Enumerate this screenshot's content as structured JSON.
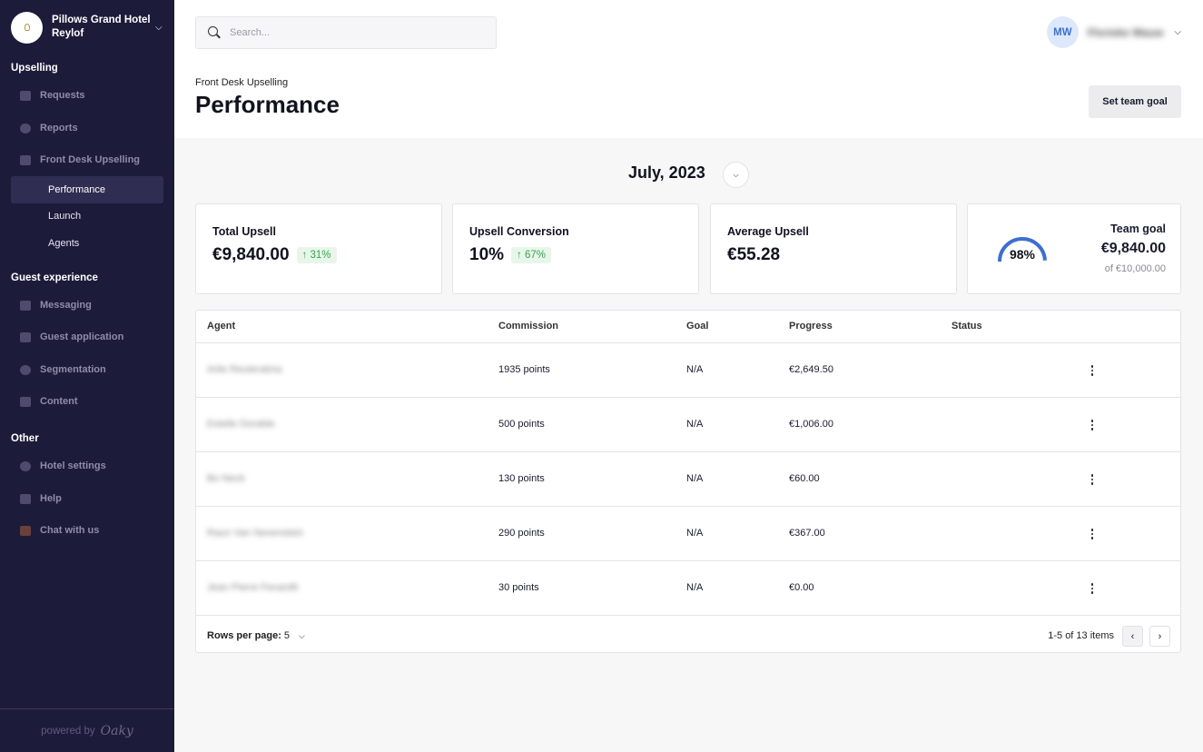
{
  "hotel": {
    "name": "Pillows Grand Hotel Reylof",
    "logo_text": "PILLOWS"
  },
  "sidebar": {
    "sections": [
      {
        "title": "Upselling"
      },
      {
        "title": "Guest experience"
      },
      {
        "title": "Other"
      }
    ],
    "items": [
      {
        "label": "Requests",
        "icon": "requests-icon"
      },
      {
        "label": "Reports",
        "icon": "pie-chart-icon"
      },
      {
        "label": "Front Desk Upselling",
        "icon": "front-desk-icon"
      },
      {
        "label": "Performance"
      },
      {
        "label": "Launch"
      },
      {
        "label": "Agents"
      },
      {
        "label": "Messaging",
        "icon": "messaging-icon"
      },
      {
        "label": "Guest application",
        "icon": "monitor-icon"
      },
      {
        "label": "Segmentation",
        "icon": "user-icon"
      },
      {
        "label": "Content",
        "icon": "content-icon"
      },
      {
        "label": "Hotel settings",
        "icon": "gear-icon"
      },
      {
        "label": "Help",
        "icon": "help-icon"
      },
      {
        "label": "Chat with us",
        "icon": "chat-icon"
      }
    ],
    "footer": {
      "powered_by": "powered by",
      "brand": "Oaky"
    }
  },
  "search": {
    "placeholder": "Search..."
  },
  "user": {
    "initials": "MW",
    "name": "Florieke Wauw"
  },
  "header": {
    "breadcrumb": "Front Desk Upselling",
    "title": "Performance",
    "goal_button": "Set team goal"
  },
  "period": {
    "label": "July, 2023"
  },
  "cards": {
    "total_upsell": {
      "label": "Total Upsell",
      "value": "€9,840.00",
      "delta": "31%"
    },
    "conversion": {
      "label": "Upsell Conversion",
      "value": "10%",
      "delta": "67%"
    },
    "average": {
      "label": "Average Upsell",
      "value": "€55.28"
    },
    "team_goal": {
      "label": "Team goal",
      "value": "€9,840.00",
      "of": "of €10,000.00",
      "percent_text": "98%",
      "percent": 98
    }
  },
  "colors": {
    "accent": "#3c6fd0",
    "sidebar": "#1d1b3a",
    "positive": "#37a550"
  },
  "table": {
    "headers": {
      "agent": "Agent",
      "commission": "Commission",
      "goal": "Goal",
      "progress": "Progress",
      "status": "Status"
    },
    "rows": [
      {
        "agent": "Arlie Reuteratma",
        "commission": "1935 points",
        "goal": "N/A",
        "progress": "€2,649.50",
        "status": ""
      },
      {
        "agent": "Estelle Dorable",
        "commission": "500 points",
        "goal": "N/A",
        "progress": "€1,006.00",
        "status": ""
      },
      {
        "agent": "Bo Neck",
        "commission": "130 points",
        "goal": "N/A",
        "progress": "€60.00",
        "status": ""
      },
      {
        "agent": "Raun Van Nevenstein",
        "commission": "290 points",
        "goal": "N/A",
        "progress": "€367.00",
        "status": ""
      },
      {
        "agent": "Jean Pierre Fenardtt",
        "commission": "30 points",
        "goal": "N/A",
        "progress": "€0.00",
        "status": ""
      }
    ],
    "footer": {
      "rows_label": "Rows per page:",
      "rows_value": "5",
      "range": "1-5 of 13 items"
    }
  }
}
